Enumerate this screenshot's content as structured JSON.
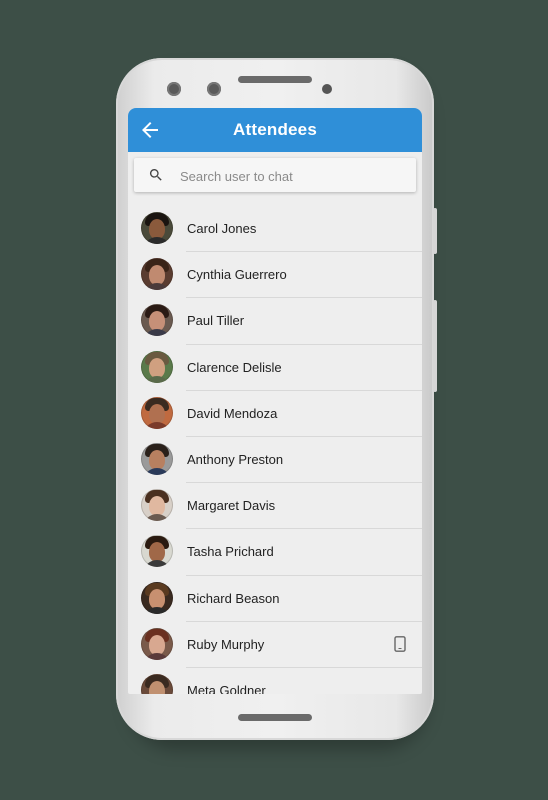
{
  "appbar": {
    "title": "Attendees",
    "color": "#2f8fd8"
  },
  "search": {
    "placeholder": "Search user to chat",
    "value": ""
  },
  "attendees": [
    {
      "name": "Carol Jones",
      "skin": "#8a5a3c",
      "hair": "#1a1410",
      "bg": "#4a4a3a",
      "shirt": "#2b2b2b"
    },
    {
      "name": "Cynthia Guerrero",
      "skin": "#c08a70",
      "hair": "#3a2418",
      "bg": "#5a3c30",
      "shirt": "#4a3a3a"
    },
    {
      "name": "Paul Tiller",
      "skin": "#c69078",
      "hair": "#2a1a14",
      "bg": "#6a5a50",
      "shirt": "#3a3a48"
    },
    {
      "name": "Clarence Delisle",
      "skin": "#d0a080",
      "hair": "#6a5a40",
      "bg": "#5a7a4a",
      "shirt": "#5a6a4a"
    },
    {
      "name": "David Mendoza",
      "skin": "#b07050",
      "hair": "#3a2a20",
      "bg": "#c06a40",
      "shirt": "#7a3a2a"
    },
    {
      "name": "Anthony Preston",
      "skin": "#b88060",
      "hair": "#2a201a",
      "bg": "#9a9a9a",
      "shirt": "#2a3a5a"
    },
    {
      "name": "Margaret Davis",
      "skin": "#e0b8a0",
      "hair": "#4a3020",
      "bg": "#d8d0c8",
      "shirt": "#6a5a50"
    },
    {
      "name": "Tasha Prichard",
      "skin": "#a06848",
      "hair": "#2a1a10",
      "bg": "#d8d8d0",
      "shirt": "#3a3a3a"
    },
    {
      "name": "Richard Beason",
      "skin": "#c89070",
      "hair": "#5a3a20",
      "bg": "#3a2a20",
      "shirt": "#2a2a2a"
    },
    {
      "name": "Ruby Murphy",
      "skin": "#d8a890",
      "hair": "#6a3020",
      "bg": "#7a5a4a",
      "shirt": "#5a3a3a",
      "device": "mobile-device-icon"
    },
    {
      "name": "Meta Goldner",
      "skin": "#c09070",
      "hair": "#3a2a20",
      "bg": "#6a4a3a",
      "shirt": "#3a3030"
    }
  ]
}
